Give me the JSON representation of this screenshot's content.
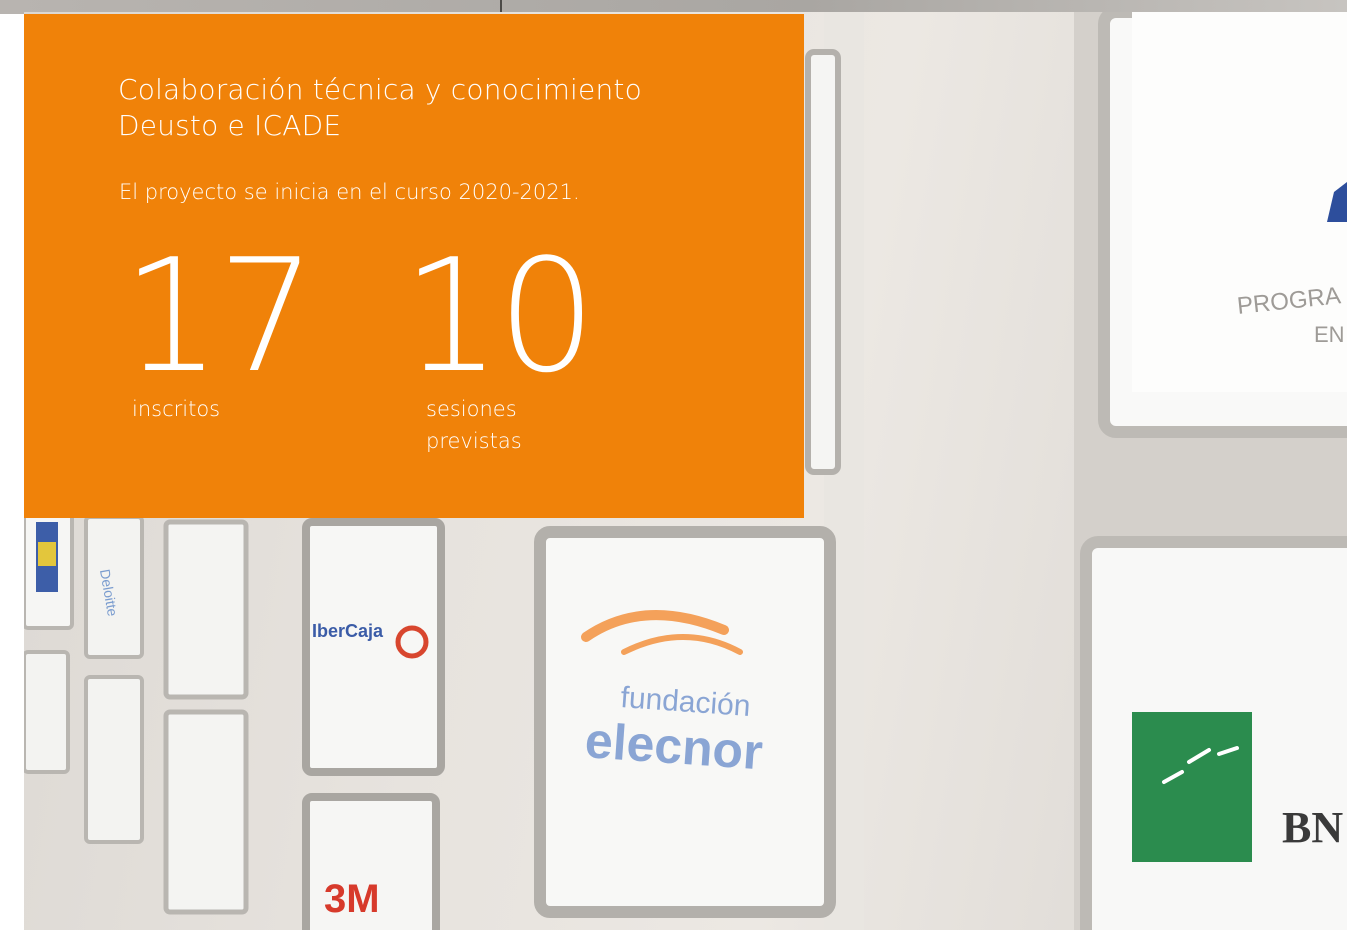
{
  "hero": {
    "title_line1": "Colaboración técnica y conocimiento",
    "title_line2": "Deusto e ICADE",
    "subtitle": "El proyecto se inicia en el curso 2020-2021."
  },
  "stats": [
    {
      "value": "17",
      "label": "inscritos"
    },
    {
      "value": "10",
      "label": "sesiones previstas"
    }
  ],
  "photo": {
    "sign_texts": [
      "Deloitte",
      "IberCaja",
      "fundación",
      "elecnor",
      "PROGRA",
      "EN",
      "BN",
      "3M"
    ]
  },
  "colors": {
    "accent": "#f08209",
    "text": "#ffffff"
  }
}
